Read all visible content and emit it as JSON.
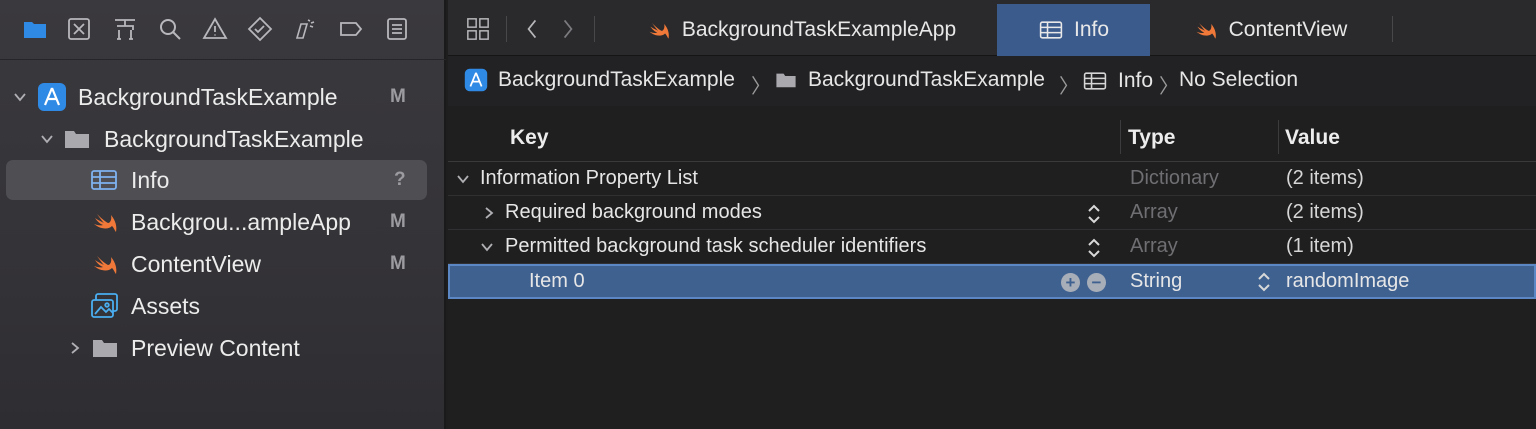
{
  "sidebar": {
    "navigator_icons": [
      "folder-icon",
      "source-control-icon",
      "symbol-icon",
      "search-icon",
      "warning-icon",
      "test-icon",
      "debug-icon",
      "breakpoint-icon",
      "report-icon"
    ],
    "tree": [
      {
        "label": "BackgroundTaskExample",
        "badge": "M",
        "icon": "app-project-icon"
      },
      {
        "label": "BackgroundTaskExample",
        "badge": "",
        "icon": "folder-icon"
      },
      {
        "label": "Info",
        "badge": "?",
        "icon": "plist-table-icon"
      },
      {
        "label": "Backgrou...ampleApp",
        "badge": "M",
        "icon": "swift-icon"
      },
      {
        "label": "ContentView",
        "badge": "M",
        "icon": "swift-icon"
      },
      {
        "label": "Assets",
        "badge": "",
        "icon": "assets-icon"
      },
      {
        "label": "Preview Content",
        "badge": "",
        "icon": "folder-icon"
      }
    ]
  },
  "tabs": [
    {
      "label": "BackgroundTaskExampleApp",
      "icon": "swift-icon"
    },
    {
      "label": "Info",
      "icon": "plist-table-icon"
    },
    {
      "label": "ContentView",
      "icon": "swift-icon"
    }
  ],
  "breadcrumb": [
    "BackgroundTaskExample",
    "BackgroundTaskExample",
    "Info",
    "No Selection"
  ],
  "plist": {
    "columns": {
      "key": "Key",
      "type": "Type",
      "value": "Value"
    },
    "rows": [
      {
        "key": "Information Property List",
        "type": "Dictionary",
        "value": "(2 items)"
      },
      {
        "key": "Required background modes",
        "type": "Array",
        "value": "(2 items)"
      },
      {
        "key": "Permitted background task scheduler identifiers",
        "type": "Array",
        "value": "(1 item)"
      },
      {
        "key": "Item 0",
        "type": "String",
        "value": "randomImage"
      }
    ]
  },
  "colors": {
    "selection_blue": "#3f6190",
    "active_tab": "#3b5b8d",
    "swift_orange": "#f0793a",
    "accent_blue": "#2f8ae5"
  }
}
